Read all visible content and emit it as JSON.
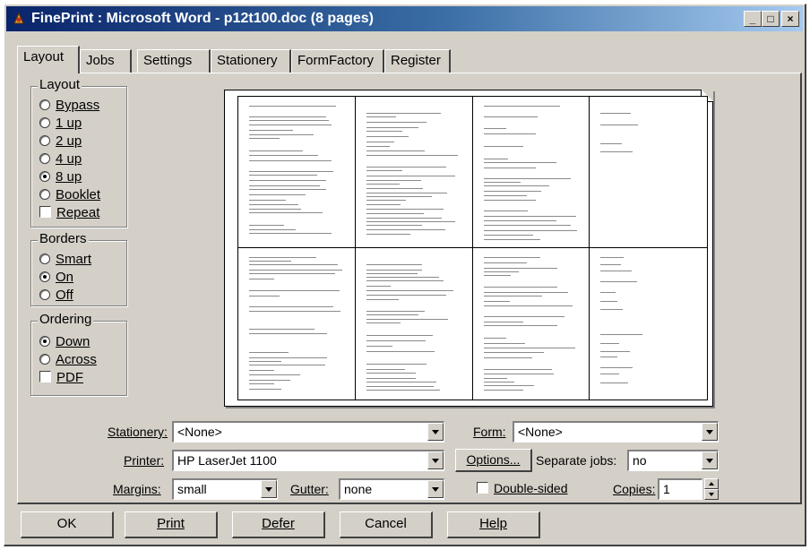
{
  "window": {
    "title": "FinePrint : Microsoft Word - p12t100.doc (8 pages)",
    "min_glyph": "_",
    "max_glyph": "□",
    "close_glyph": "×"
  },
  "tabs": [
    {
      "label": "Layout",
      "active": true
    },
    {
      "label": "Jobs",
      "active": false
    },
    {
      "label": "Settings",
      "active": false
    },
    {
      "label": "Stationery",
      "active": false
    },
    {
      "label": "FormFactory",
      "active": false
    },
    {
      "label": "Register",
      "active": false
    }
  ],
  "layout_group": {
    "legend": "Layout",
    "options": [
      {
        "label": "Bypass",
        "checked": false
      },
      {
        "label": "1 up",
        "checked": false
      },
      {
        "label": "2 up",
        "checked": false
      },
      {
        "label": "4 up",
        "checked": false
      },
      {
        "label": "8 up",
        "checked": true
      },
      {
        "label": "Booklet",
        "checked": false
      }
    ],
    "repeat_label": "Repeat",
    "repeat_checked": false
  },
  "borders_group": {
    "legend": "Borders",
    "options": [
      {
        "label": "Smart",
        "checked": false
      },
      {
        "label": "On",
        "checked": true
      },
      {
        "label": "Off",
        "checked": false
      }
    ]
  },
  "ordering_group": {
    "legend": "Ordering",
    "options": [
      {
        "label": "Down",
        "checked": true
      },
      {
        "label": "Across",
        "checked": false
      }
    ],
    "pdf_label": "PDF",
    "pdf_checked": false
  },
  "fields": {
    "stationery_label": "Stationery:",
    "stationery_value": "<None>",
    "form_label": "Form:",
    "form_value": "<None>",
    "printer_label": "Printer:",
    "printer_value": "HP LaserJet 1100",
    "options_button": "Options...",
    "separate_jobs_label": "Separate jobs:",
    "separate_jobs_value": "no",
    "margins_label": "Margins:",
    "margins_value": "small",
    "gutter_label": "Gutter:",
    "gutter_value": "none",
    "double_sided_label": "Double-sided",
    "double_sided_checked": false,
    "copies_label": "Copies:",
    "copies_value": "1"
  },
  "buttons": {
    "ok": "OK",
    "print": "Print",
    "defer": "Defer",
    "cancel": "Cancel",
    "help": "Help"
  },
  "colors": {
    "title_active": "#0a246a",
    "face": "#d4d0c8"
  }
}
